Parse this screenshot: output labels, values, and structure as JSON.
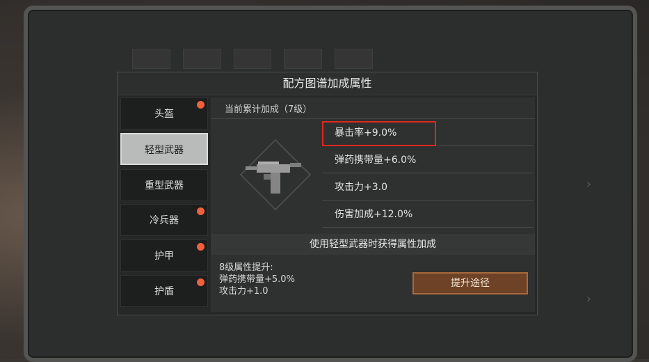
{
  "modal": {
    "title": "配方图谱加成属性"
  },
  "sidebar": {
    "items": [
      {
        "label": "头盔",
        "badge": true,
        "active": false
      },
      {
        "label": "轻型武器",
        "badge": false,
        "active": true
      },
      {
        "label": "重型武器",
        "badge": false,
        "active": false
      },
      {
        "label": "冷兵器",
        "badge": true,
        "active": false
      },
      {
        "label": "护甲",
        "badge": true,
        "active": false
      },
      {
        "label": "护盾",
        "badge": true,
        "active": false
      }
    ]
  },
  "summary": {
    "label": "当前累计加成（7级）",
    "stats": [
      "暴击率+9.0%",
      "弹药携带量+6.0%",
      "攻击力+3.0",
      "伤害加成+12.0%"
    ]
  },
  "bonus_bar": {
    "text": "使用轻型武器时获得属性加成"
  },
  "next_level": {
    "line1": "8级属性提升:",
    "line2": "弹药携带量+5.0%",
    "line3": "攻击力+1.0"
  },
  "upgrade_button": {
    "label": "提升途径"
  },
  "colors": {
    "badge": "#f0603a",
    "highlight": "#e0271f",
    "button": "#6e4226"
  },
  "icons": {
    "weapon": "uzi-smg-icon"
  }
}
